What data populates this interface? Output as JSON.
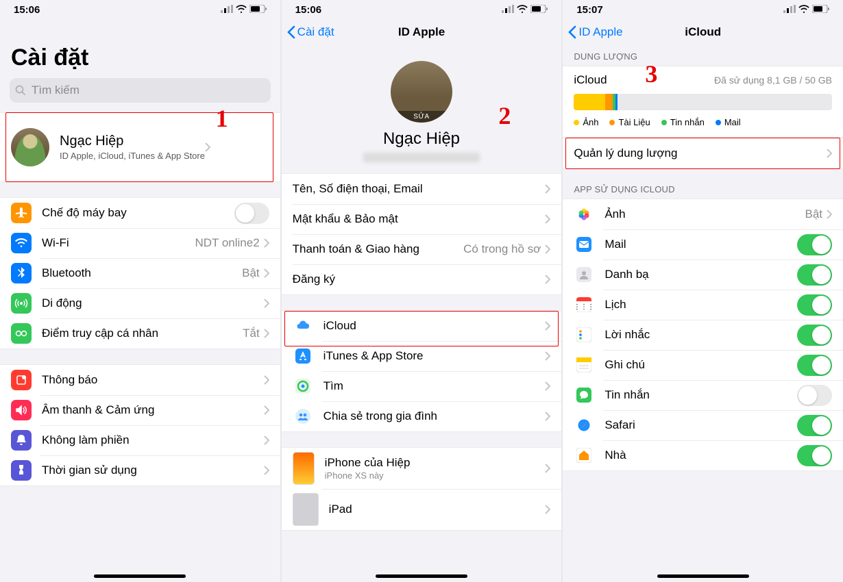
{
  "pane1": {
    "time": "15:06",
    "title": "Cài đặt",
    "search_placeholder": "Tìm kiếm",
    "step": "1",
    "user": {
      "name": "Ngạc Hiệp",
      "sub": "ID Apple, iCloud, iTunes & App Store"
    },
    "rows1": [
      {
        "icon": "airplane",
        "color": "#ff9500",
        "label": "Chế độ máy bay",
        "ctrl": "toggle-off"
      },
      {
        "icon": "wifi",
        "color": "#007aff",
        "label": "Wi-Fi",
        "detail": "NDT online2"
      },
      {
        "icon": "bluetooth",
        "color": "#007aff",
        "label": "Bluetooth",
        "detail": "Bật"
      },
      {
        "icon": "cell",
        "color": "#34c759",
        "label": "Di động"
      },
      {
        "icon": "hotspot",
        "color": "#34c759",
        "label": "Điểm truy cập cá nhân",
        "detail": "Tắt"
      }
    ],
    "rows2": [
      {
        "icon": "notif",
        "color": "#ff3b30",
        "label": "Thông báo"
      },
      {
        "icon": "sound",
        "color": "#ff2d55",
        "label": "Âm thanh & Cảm ứng"
      },
      {
        "icon": "dnd",
        "color": "#5856d6",
        "label": "Không làm phiền"
      },
      {
        "icon": "screentime",
        "color": "#5856d6",
        "label": "Thời gian sử dụng"
      }
    ]
  },
  "pane2": {
    "time": "15:06",
    "back": "Cài đặt",
    "title": "ID Apple",
    "step": "2",
    "profile_name": "Ngạc Hiệp",
    "rows1": [
      {
        "label": "Tên, Số điện thoại, Email"
      },
      {
        "label": "Mật khẩu & Bảo mật"
      },
      {
        "label": "Thanh toán & Giao hàng",
        "detail": "Có trong hồ sơ"
      },
      {
        "label": "Đăng ký"
      }
    ],
    "rows2": [
      {
        "icon": "icloud",
        "label": "iCloud"
      },
      {
        "icon": "appstore",
        "label": "iTunes & App Store"
      },
      {
        "icon": "findmy",
        "label": "Tìm"
      },
      {
        "icon": "family",
        "label": "Chia sẻ trong gia đình"
      }
    ],
    "devices": [
      {
        "name": "iPhone của Hiệp",
        "model": "iPhone XS này",
        "type": "phone"
      },
      {
        "name": "iPad",
        "model": "",
        "type": "ipad"
      }
    ]
  },
  "pane3": {
    "time": "15:07",
    "back": "ID Apple",
    "title": "iCloud",
    "step": "3",
    "storage_header": "DUNG LƯỢNG",
    "storage_title": "iCloud",
    "storage_used": "Đã sử dụng 8,1 GB / 50 GB",
    "segments": [
      {
        "color": "#ffcc00",
        "pct": 12
      },
      {
        "color": "#ff9500",
        "pct": 3
      },
      {
        "color": "#34c759",
        "pct": 1.2
      },
      {
        "color": "#007aff",
        "pct": 0.8
      }
    ],
    "legend": [
      {
        "color": "#ffcc00",
        "label": "Ảnh"
      },
      {
        "color": "#ff9500",
        "label": "Tài Liệu"
      },
      {
        "color": "#34c759",
        "label": "Tin nhắn"
      },
      {
        "color": "#007aff",
        "label": "Mail"
      }
    ],
    "manage": "Quản lý dung lượng",
    "apps_header": "APP SỬ DỤNG ICLOUD",
    "apps": [
      {
        "icon": "photos",
        "label": "Ảnh",
        "detail": "Bật",
        "ctrl": "chev"
      },
      {
        "icon": "mail",
        "label": "Mail",
        "ctrl": "toggle-on"
      },
      {
        "icon": "contacts",
        "label": "Danh bạ",
        "ctrl": "toggle-on"
      },
      {
        "icon": "calendar",
        "label": "Lịch",
        "ctrl": "toggle-on"
      },
      {
        "icon": "reminders",
        "label": "Lời nhắc",
        "ctrl": "toggle-on"
      },
      {
        "icon": "notes",
        "label": "Ghi chú",
        "ctrl": "toggle-on"
      },
      {
        "icon": "messages",
        "label": "Tin nhắn",
        "ctrl": "toggle-off"
      },
      {
        "icon": "safari",
        "label": "Safari",
        "ctrl": "toggle-on"
      },
      {
        "icon": "home",
        "label": "Nhà",
        "ctrl": "toggle-on"
      }
    ]
  }
}
